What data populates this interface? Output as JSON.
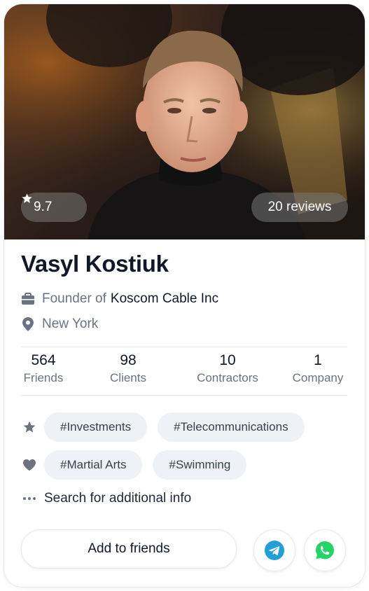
{
  "profile": {
    "name": "Vasyl Kostiuk",
    "rating": "9.7",
    "reviews": "20 reviews",
    "job_prefix": "Founder of",
    "company": "Koscom Cable Inc",
    "location": "New York"
  },
  "stats": [
    {
      "value": "564",
      "label": "Friends"
    },
    {
      "value": "98",
      "label": "Clients"
    },
    {
      "value": "10",
      "label": "Contractors"
    },
    {
      "value": "1",
      "label": "Company"
    }
  ],
  "interests": {
    "professional": [
      "#Investments",
      "#Telecommunications"
    ],
    "hobbies": [
      "#Martial Arts",
      "#Swimming"
    ]
  },
  "more_info_label": "Search for additional info",
  "actions": {
    "add_friend_label": "Add to friends"
  },
  "icons": {
    "rating": "star-icon",
    "job": "briefcase-icon",
    "location": "location-pin-icon",
    "professional": "star-icon",
    "hobbies": "heart-icon",
    "more": "more-dots-icon",
    "telegram": "telegram-icon",
    "whatsapp": "whatsapp-icon"
  },
  "colors": {
    "telegram": "#229ED9",
    "whatsapp": "#25D366",
    "icon_gray": "#6b7280",
    "tag_bg": "#eef1f5"
  }
}
